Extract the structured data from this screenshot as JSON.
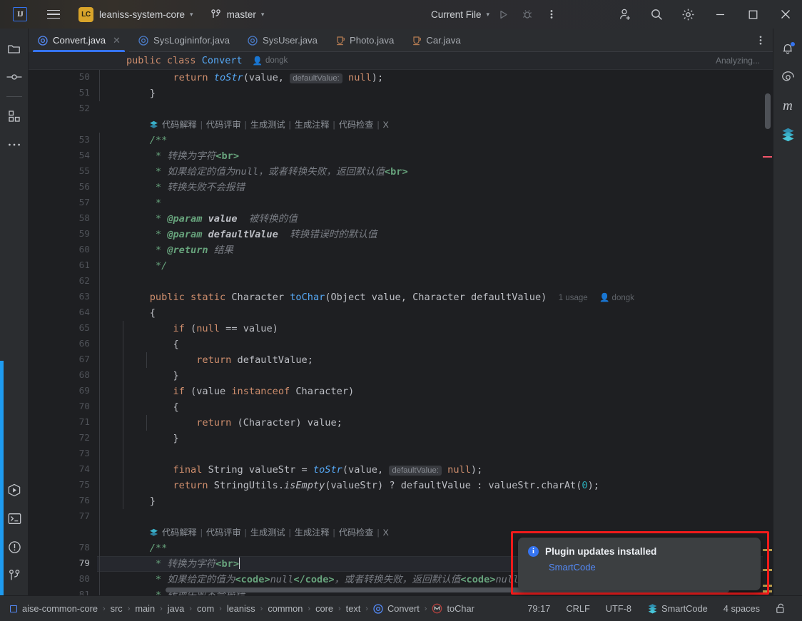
{
  "titlebar": {
    "logo": "IJ",
    "menu_icon": "hamburger-icon",
    "project_badge": "LC",
    "project_name": "leaniss-system-core",
    "branch": "master",
    "run_config": "Current File",
    "chevron": "⌄",
    "icons": {
      "run": "run-icon",
      "debug": "debug-icon",
      "more": "more-vertical-icon",
      "share": "add-user-icon",
      "search": "search-icon",
      "settings": "gear-icon",
      "minimize": "minimize-icon",
      "maximize": "maximize-icon",
      "close": "close-icon"
    }
  },
  "left_strip": [
    {
      "name": "project-tool-window",
      "icon": "folder-icon"
    },
    {
      "name": "commit-tool-window",
      "icon": "commit-icon"
    },
    {
      "name": "structure-tool-window",
      "icon": "structure-icon"
    },
    {
      "name": "more-tool-windows",
      "icon": "ellipsis-icon"
    }
  ],
  "left_strip_bottom": [
    {
      "name": "run-tool-window",
      "icon": "run-hex-icon"
    },
    {
      "name": "terminal-tool-window",
      "icon": "terminal-icon"
    },
    {
      "name": "problems-tool-window",
      "icon": "warning-circle-icon"
    },
    {
      "name": "git-tool-window",
      "icon": "git-branch-icon"
    }
  ],
  "right_strip": [
    {
      "name": "notifications",
      "icon": "bell-icon",
      "badge": true
    },
    {
      "name": "ai-assistant",
      "icon": "spiral-icon"
    },
    {
      "name": "maven",
      "icon": "maven-m-icon"
    },
    {
      "name": "smartcode",
      "icon": "smartcode-icon"
    }
  ],
  "tabs": [
    {
      "label": "Convert.java",
      "icon": "java-class-icon",
      "active": true,
      "closable": true
    },
    {
      "label": "SysLogininfor.java",
      "icon": "java-class-icon",
      "active": false
    },
    {
      "label": "SysUser.java",
      "icon": "java-class-icon",
      "active": false
    },
    {
      "label": "Photo.java",
      "icon": "java-file-icon",
      "active": false
    },
    {
      "label": "Car.java",
      "icon": "java-file-icon",
      "active": false
    }
  ],
  "sticky_header": {
    "declaration": "public class Convert",
    "author": "dongk",
    "status": "Analyzing..."
  },
  "ai_action_bar": {
    "items": [
      "代码解释",
      "代码评审",
      "生成测试",
      "生成注释",
      "代码检查",
      "X"
    ],
    "separator": "|"
  },
  "editor": {
    "first_line": 50,
    "caret_line": 79,
    "lines": [
      {
        "n": 50,
        "type": "code"
      },
      {
        "n": 51,
        "type": "code"
      },
      {
        "n": 52,
        "type": "code"
      },
      {
        "n": "",
        "type": "aibar"
      },
      {
        "n": 53,
        "type": "code"
      },
      {
        "n": 54,
        "type": "code"
      },
      {
        "n": 55,
        "type": "code"
      },
      {
        "n": 56,
        "type": "code"
      },
      {
        "n": 57,
        "type": "code"
      },
      {
        "n": 58,
        "type": "code"
      },
      {
        "n": 59,
        "type": "code"
      },
      {
        "n": 60,
        "type": "code"
      },
      {
        "n": 61,
        "type": "code"
      },
      {
        "n": 62,
        "type": "code"
      },
      {
        "n": 63,
        "type": "code"
      },
      {
        "n": 64,
        "type": "code"
      },
      {
        "n": 65,
        "type": "code"
      },
      {
        "n": 66,
        "type": "code"
      },
      {
        "n": 67,
        "type": "code"
      },
      {
        "n": 68,
        "type": "code"
      },
      {
        "n": 69,
        "type": "code"
      },
      {
        "n": 70,
        "type": "code"
      },
      {
        "n": 71,
        "type": "code"
      },
      {
        "n": 72,
        "type": "code"
      },
      {
        "n": 73,
        "type": "code"
      },
      {
        "n": 74,
        "type": "code"
      },
      {
        "n": 75,
        "type": "code"
      },
      {
        "n": 76,
        "type": "code"
      },
      {
        "n": 77,
        "type": "code"
      },
      {
        "n": "",
        "type": "aibar"
      },
      {
        "n": 78,
        "type": "code"
      },
      {
        "n": 79,
        "type": "code"
      },
      {
        "n": 80,
        "type": "code"
      },
      {
        "n": 81,
        "type": "code"
      }
    ],
    "source": [
      "        return toStr(value, [defaultValue:] null);",
      "    }",
      "",
      "    /**",
      "     * 转换为字符<br>",
      "     * 如果给定的值为null，或者转换失败，返回默认值<br>",
      "     * 转换失败不会报错",
      "     *",
      "     * @param value 被转换的值",
      "     * @param defaultValue 转换错误时的默认值",
      "     * @return 结果",
      "     */",
      "",
      "    public static Character toChar(Object value, Character defaultValue)",
      "    {",
      "        if (null == value)",
      "        {",
      "            return defaultValue;",
      "        }",
      "        if (value instanceof Character)",
      "        {",
      "            return (Character) value;",
      "        }",
      "",
      "        final String valueStr = toStr(value, [defaultValue:] null);",
      "        return StringUtils.isEmpty(valueStr) ? defaultValue : valueStr.charAt(0);",
      "    }",
      "",
      "    /**",
      "     * 转换为字符<br>",
      "     * 如果给定的值为<code>null</code>，或者转换失败，返回默认值<code>null</code>",
      "     * 转换失败不会报错"
    ],
    "inlay_hints": [
      "defaultValue:"
    ],
    "usage_badge": "1 usage",
    "author_badge": "dongk"
  },
  "notification": {
    "icon": "info-icon",
    "icon_glyph": "i",
    "title": "Plugin updates installed",
    "link": "SmartCode",
    "highlight_color": "#f21b1b"
  },
  "status_bar": {
    "breadcrumbs": [
      "aise-common-core",
      "src",
      "main",
      "java",
      "com",
      "leaniss",
      "common",
      "core",
      "text",
      "Convert",
      "toChar"
    ],
    "breadcrumb_separator": "›",
    "module_icon": "module-icon",
    "class_icon": "java-class-icon",
    "method_icon": "method-icon",
    "position": "79:17",
    "line_separator": "CRLF",
    "encoding": "UTF-8",
    "plugin": "SmartCode",
    "indent": "4 spaces",
    "lock_icon": "unlocked-icon"
  },
  "colors": {
    "accent": "#3574f0",
    "editor_bg": "#1e1f22",
    "panel_bg": "#2b2d30",
    "notification_highlight": "#f21b1b",
    "left_accent_bar": "#1e9bf0"
  }
}
